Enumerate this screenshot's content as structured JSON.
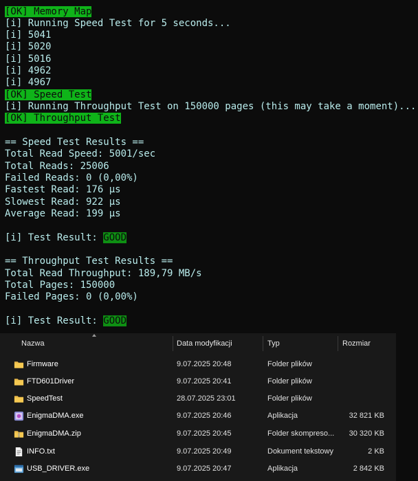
{
  "terminal": {
    "lines": [
      {
        "pre": "",
        "hl": "[OK] Memory Map",
        "post": ""
      },
      {
        "pre": "[i] Running Speed Test for 5 seconds...",
        "hl": "",
        "post": ""
      },
      {
        "pre": "[i] 5041",
        "hl": "",
        "post": ""
      },
      {
        "pre": "[i] 5020",
        "hl": "",
        "post": ""
      },
      {
        "pre": "[i] 5016",
        "hl": "",
        "post": ""
      },
      {
        "pre": "[i] 4962",
        "hl": "",
        "post": ""
      },
      {
        "pre": "[i] 4967",
        "hl": "",
        "post": ""
      },
      {
        "pre": "",
        "hl": "[OK] Speed Test",
        "post": ""
      },
      {
        "pre": "[i] Running Throughput Test on 150000 pages (this may take a moment)...",
        "hl": "",
        "post": ""
      },
      {
        "pre": "",
        "hl": "[OK] Throughput Test",
        "post": ""
      },
      {
        "pre": "== Speed Test Results ==",
        "hl": "",
        "post": ""
      },
      {
        "pre": "Total Read Speed: 5001/sec",
        "hl": "",
        "post": ""
      },
      {
        "pre": "Total Reads: 25006",
        "hl": "",
        "post": ""
      },
      {
        "pre": "Failed Reads: 0 (0,00%)",
        "hl": "",
        "post": ""
      },
      {
        "pre": "Fastest Read: 176 µs",
        "hl": "",
        "post": ""
      },
      {
        "pre": "Slowest Read: 922 µs",
        "hl": "",
        "post": ""
      },
      {
        "pre": "Average Read: 199 µs",
        "hl": "",
        "post": ""
      },
      {
        "pre": "[i] Test Result: ",
        "hl": "GOOD",
        "post": ""
      },
      {
        "pre": "== Throughput Test Results ==",
        "hl": "",
        "post": ""
      },
      {
        "pre": "Total Read Throughput: 189,79 MB/s",
        "hl": "",
        "post": ""
      },
      {
        "pre": "Total Pages: 150000",
        "hl": "",
        "post": ""
      },
      {
        "pre": "Failed Pages: 0 (0,00%)",
        "hl": "",
        "post": ""
      },
      {
        "pre": "[i] Test Result: ",
        "hl": "GOOD",
        "post": ""
      }
    ]
  },
  "explorer": {
    "columns": {
      "name": "Nazwa",
      "date": "Data modyfikacji",
      "type": "Typ",
      "size": "Rozmiar"
    },
    "files": [
      {
        "name": "Firmware",
        "date": "9.07.2025 20:48",
        "type": "Folder plików",
        "size": "",
        "icon": "folder-icon"
      },
      {
        "name": "FTD601Driver",
        "date": "9.07.2025 20:41",
        "type": "Folder plików",
        "size": "",
        "icon": "folder-icon"
      },
      {
        "name": "SpeedTest",
        "date": "28.07.2025 23:01",
        "type": "Folder plików",
        "size": "",
        "icon": "folder-icon"
      },
      {
        "name": "EnigmaDMA.exe",
        "date": "9.07.2025 20:46",
        "type": "Aplikacja",
        "size": "32 821 KB",
        "icon": "exe-app-icon"
      },
      {
        "name": "EnigmaDMA.zip",
        "date": "9.07.2025 20:45",
        "type": "Folder skompreso...",
        "size": "30 320 KB",
        "icon": "zip-folder-icon"
      },
      {
        "name": "INFO.txt",
        "date": "9.07.2025 20:49",
        "type": "Dokument tekstowy",
        "size": "2 KB",
        "icon": "text-file-icon"
      },
      {
        "name": "USB_DRIVER.exe",
        "date": "9.07.2025 20:47",
        "type": "Aplikacja",
        "size": "2 842 KB",
        "icon": "exe-app-icon"
      }
    ]
  },
  "colors": {
    "terminal_bg": "#0c0c0c",
    "terminal_text": "#b9ecec",
    "ok_highlight": "#0fb319",
    "good_highlight": "#0e8f13",
    "explorer_bg": "#191919"
  }
}
